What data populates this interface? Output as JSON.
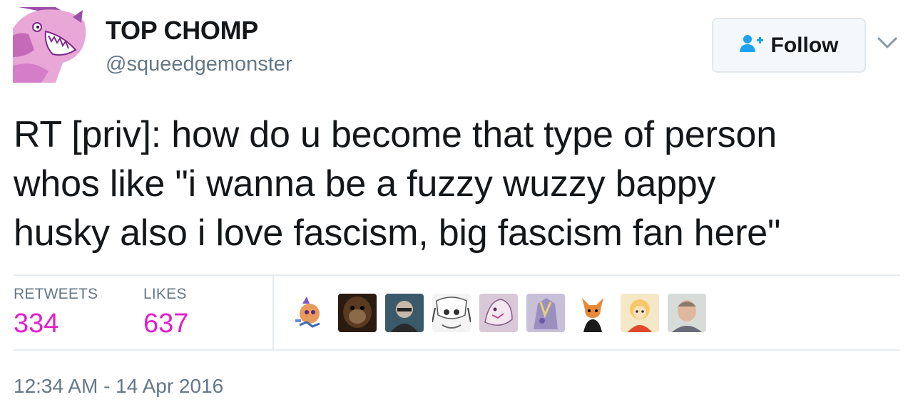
{
  "user": {
    "name": "TOP CHOMP",
    "handle": "@squeedgemonster"
  },
  "follow_button": {
    "label": "Follow",
    "icon": "add-user-icon"
  },
  "menu": {
    "icon": "chevron-down-icon"
  },
  "tweet": {
    "lines": [
      "RT [priv]: how do u become that type of person",
      "whos like \"i wanna be a fuzzy wuzzy bappy",
      "husky also i love fascism, big fascism fan here\""
    ]
  },
  "stats": {
    "retweets_label": "RETWEETS",
    "retweets_value": "334",
    "likes_label": "LIKES",
    "likes_value": "637"
  },
  "timestamp": "12:34 AM - 14 Apr 2016",
  "colors": {
    "accent": "#e31ecc",
    "muted": "#657786",
    "follow_icon": "#1da1f2",
    "border": "#e6ecf0"
  }
}
